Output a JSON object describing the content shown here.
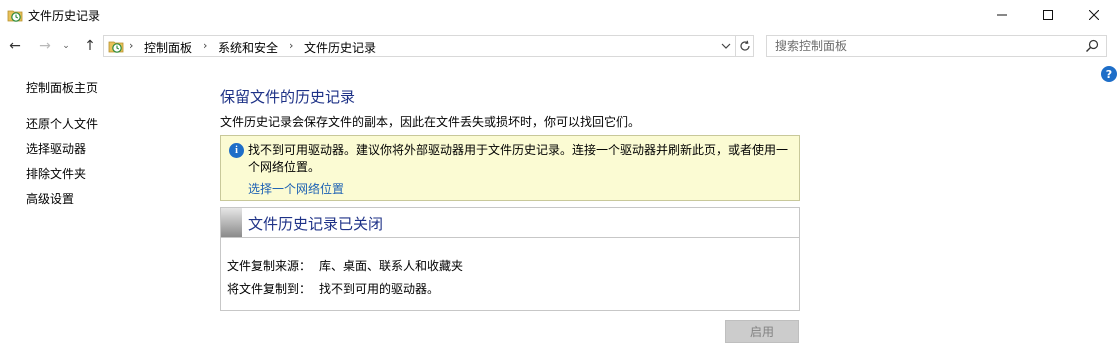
{
  "window": {
    "title": "文件历史记录",
    "icon": "file-history-icon",
    "controls": {
      "minimize": "minimize-icon",
      "maximize": "maximize-icon",
      "close": "close-icon"
    }
  },
  "nav": {
    "back": "←",
    "forward": "→",
    "recent": "⌄",
    "up": "↑"
  },
  "address": {
    "breadcrumbs": [
      "控制面板",
      "系统和安全",
      "文件历史记录"
    ],
    "separator": "›"
  },
  "search": {
    "placeholder": "搜索控制面板"
  },
  "help": "?",
  "sidebar": {
    "items": [
      {
        "label": "控制面板主页"
      },
      {
        "label": "还原个人文件"
      },
      {
        "label": "选择驱动器"
      },
      {
        "label": "排除文件夹"
      },
      {
        "label": "高级设置"
      }
    ]
  },
  "main": {
    "title": "保留文件的历史记录",
    "description": "文件历史记录会保存文件的副本，因此在文件丢失或损坏时，你可以找回它们。",
    "warning": {
      "icon": "i",
      "text": "找不到可用驱动器。建议你将外部驱动器用于文件历史记录。连接一个驱动器并刷新此页，或者使用一个网络位置。",
      "link": "选择一个网络位置"
    },
    "status": {
      "title": "文件历史记录已关闭",
      "rows": [
        {
          "label": "文件复制来源：",
          "value": "库、桌面、联系人和收藏夹"
        },
        {
          "label": "将文件复制到：",
          "value": "找不到可用的驱动器。"
        }
      ]
    },
    "enable_button": "启用"
  },
  "colors": {
    "heading": "#1e3287",
    "link": "#1e62b4",
    "warning_bg": "#fbfbd3",
    "info_blue": "#1e6ec8"
  }
}
